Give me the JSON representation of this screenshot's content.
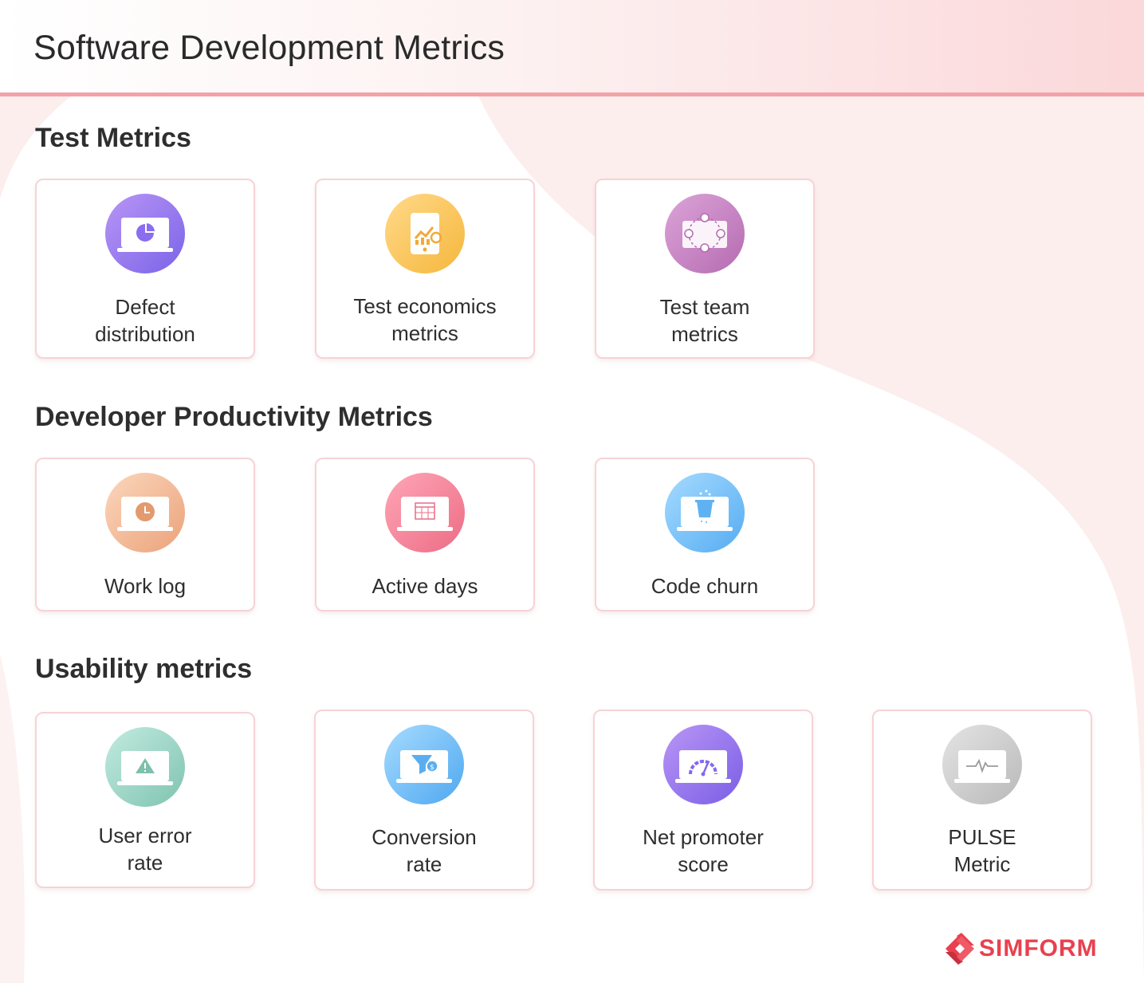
{
  "title": "Software Development Metrics",
  "sections": [
    {
      "title": "Test Metrics",
      "cards": [
        {
          "line1": "Defect",
          "line2": "distribution",
          "icon": "pie-chart-laptop-icon"
        },
        {
          "line1": "Test economics",
          "line2": "metrics",
          "icon": "growth-chart-tablet-icon"
        },
        {
          "line1": "Test team",
          "line2": "metrics",
          "icon": "team-network-icon"
        }
      ]
    },
    {
      "title": "Developer Productivity Metrics",
      "cards": [
        {
          "line1": "Work log",
          "line2": "",
          "icon": "clock-laptop-icon"
        },
        {
          "line1": "Active days",
          "line2": "",
          "icon": "calendar-laptop-icon"
        },
        {
          "line1": "Code churn",
          "line2": "",
          "icon": "bucket-laptop-icon"
        }
      ]
    },
    {
      "title": "Usability metrics",
      "cards": [
        {
          "line1": "User error",
          "line2": "rate",
          "icon": "warning-laptop-icon"
        },
        {
          "line1": "Conversion",
          "line2": "rate",
          "icon": "funnel-dollar-icon"
        },
        {
          "line1": "Net promoter",
          "line2": "score",
          "icon": "speedometer-laptop-icon"
        },
        {
          "line1": "PULSE",
          "line2": "Metric",
          "icon": "pulse-laptop-icon"
        }
      ]
    }
  ],
  "brand": {
    "name": "SIMFORM",
    "color": "#e8414f"
  }
}
